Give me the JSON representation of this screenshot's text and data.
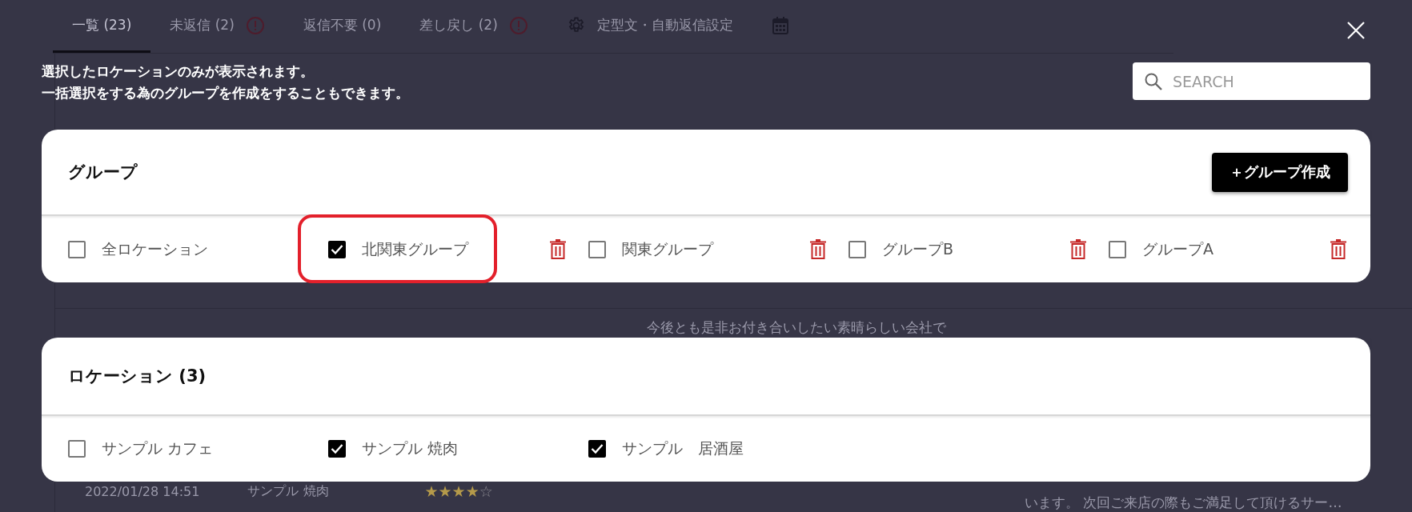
{
  "tabs": [
    {
      "kind": "text",
      "label": "一覧 (23)",
      "selected": true,
      "alert": false
    },
    {
      "kind": "text",
      "label": "未返信 (2)",
      "selected": false,
      "alert": true
    },
    {
      "kind": "text",
      "label": "返信不要 (0)",
      "selected": false,
      "alert": false
    },
    {
      "kind": "text",
      "label": "差し戻し (2)",
      "selected": false,
      "alert": true
    },
    {
      "kind": "settings",
      "label": "定型文・自動返信設定",
      "selected": false,
      "alert": false
    },
    {
      "kind": "calendar",
      "selected": false,
      "alert": false
    }
  ],
  "background_review": {
    "comment_line": "今後とも是非お付き合いしたい素晴らしい会社で"
  },
  "background_row": {
    "date": "2022/01/28 14:51",
    "location": "サンプル 焼肉",
    "stars": 4,
    "comment": "います。 次回ご来店の際もご満足して頂けるサー…"
  },
  "modal": {
    "intro": [
      "選択したロケーションのみが表示されます。",
      "一括選択をする為のグループを作成をすることもできます。"
    ],
    "search": {
      "placeholder": "SEARCH"
    },
    "groups": {
      "title": "グループ",
      "create_button": "＋グループ作成",
      "items": [
        {
          "label": "全ロケーション",
          "checked": false,
          "deletable": false,
          "highlighted": false
        },
        {
          "label": "北関東グループ",
          "checked": true,
          "deletable": true,
          "highlighted": true
        },
        {
          "label": "関東グループ",
          "checked": false,
          "deletable": true,
          "highlighted": false
        },
        {
          "label": "グループB",
          "checked": false,
          "deletable": true,
          "highlighted": false
        },
        {
          "label": "グループA",
          "checked": false,
          "deletable": true,
          "highlighted": false
        }
      ]
    },
    "locations": {
      "title": "ロケーション (3)",
      "items": [
        {
          "label": "サンプル カフェ",
          "checked": false
        },
        {
          "label": "サンプル 焼肉",
          "checked": true
        },
        {
          "label": "サンプル　居酒屋",
          "checked": true
        }
      ]
    }
  }
}
